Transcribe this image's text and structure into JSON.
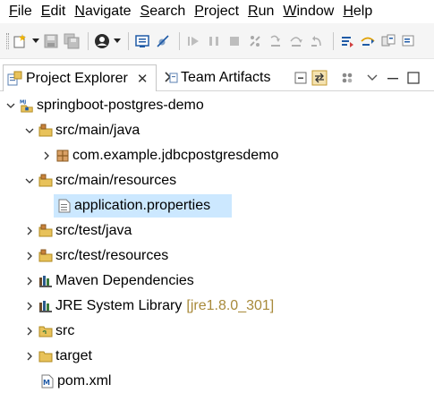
{
  "menu": [
    {
      "label": "File",
      "mnemonic": "F",
      "rest": "ile"
    },
    {
      "label": "Edit",
      "mnemonic": "E",
      "rest": "dit"
    },
    {
      "label": "Navigate",
      "mnemonic": "N",
      "rest": "avigate"
    },
    {
      "label": "Search",
      "mnemonic": "S",
      "rest": "earch"
    },
    {
      "label": "Project",
      "mnemonic": "P",
      "rest": "roject"
    },
    {
      "label": "Run",
      "mnemonic": "R",
      "rest": "un"
    },
    {
      "label": "Window",
      "mnemonic": "W",
      "rest": "indow"
    },
    {
      "label": "Help",
      "mnemonic": "H",
      "rest": "elp"
    }
  ],
  "tabs": {
    "active": {
      "label": "Project Explorer",
      "icon": "project-explorer-icon"
    },
    "inactive": {
      "label": "Team Artifacts",
      "icon": "team-artifacts-icon"
    }
  },
  "tree": {
    "project": "springboot-postgres-demo",
    "items": [
      {
        "label": "src/main/java",
        "icon": "source-folder-icon",
        "expanded": true
      },
      {
        "label": "com.example.jdbcpostgresdemo",
        "icon": "package-icon",
        "expanded": false
      },
      {
        "label": "src/main/resources",
        "icon": "source-folder-icon",
        "expanded": true
      },
      {
        "label": "application.properties",
        "icon": "properties-file-icon",
        "selected": true
      },
      {
        "label": "src/test/java",
        "icon": "source-folder-icon",
        "expanded": false
      },
      {
        "label": "src/test/resources",
        "icon": "source-folder-icon",
        "expanded": false
      },
      {
        "label": "Maven Dependencies",
        "icon": "library-icon",
        "expanded": false
      },
      {
        "label": "JRE System Library",
        "decoration": "[jre1.8.0_301]",
        "icon": "library-icon",
        "expanded": false
      },
      {
        "label": "src",
        "icon": "folder-icon",
        "expanded": false
      },
      {
        "label": "target",
        "icon": "folder-icon",
        "expanded": false
      },
      {
        "label": "pom.xml",
        "icon": "maven-file-icon"
      }
    ]
  },
  "colors": {
    "selection": "#cce8ff",
    "decoration": "#a88a3a",
    "folder": "#e8c25a"
  }
}
